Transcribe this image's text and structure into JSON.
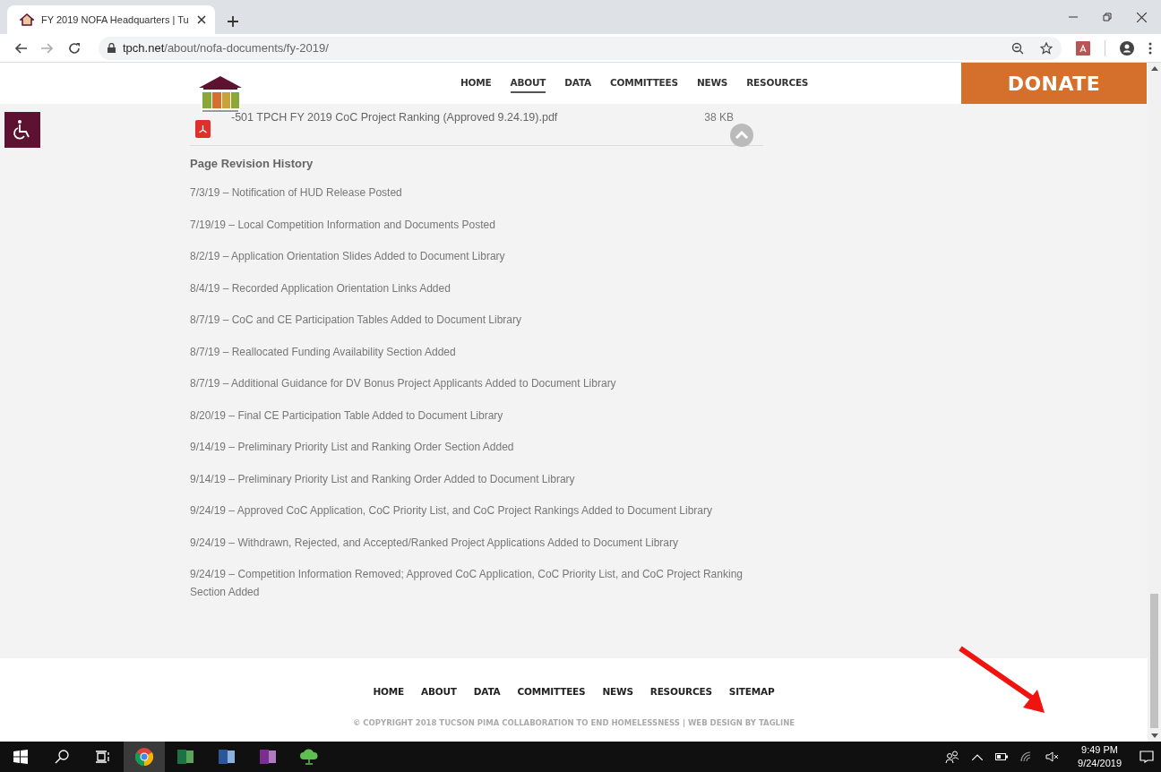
{
  "browser": {
    "tab_title": "FY 2019 NOFA Headquarters | Tu",
    "url_host": "tpch.net",
    "url_path": "/about/nofa-documents/fy-2019/"
  },
  "nav": [
    {
      "label": "HOME",
      "selected": false
    },
    {
      "label": "ABOUT",
      "selected": true
    },
    {
      "label": "DATA",
      "selected": false
    },
    {
      "label": "COMMITTEES",
      "selected": false
    },
    {
      "label": "NEWS",
      "selected": false
    },
    {
      "label": "RESOURCES",
      "selected": false
    }
  ],
  "donate": "DONATE",
  "document": {
    "name": "-501 TPCH FY 2019 CoC Project Ranking (Approved 9.24.19).pdf",
    "size": "38 KB"
  },
  "revision_history": {
    "heading": "Page Revision History",
    "entries": [
      "7/3/19 – Notification of HUD Release Posted",
      "7/19/19 – Local Competition Information and Documents Posted",
      "8/2/19 – Application Orientation Slides Added to Document Library",
      "8/4/19 – Recorded Application Orientation Links Added",
      "8/7/19 – CoC and CE Participation Tables Added to Document Library",
      "8/7/19 – Reallocated Funding Availability Section Added",
      "8/7/19 – Additional Guidance for DV Bonus Project Applicants Added to Document Library",
      "8/20/19 – Final CE Participation Table Added to Document Library",
      "9/14/19 – Preliminary Priority List and Ranking Order Section Added",
      "9/14/19 – Preliminary Priority List and Ranking Order Added to Document Library",
      "9/24/19 – Approved CoC Application, CoC Priority List, and CoC Project Rankings Added to Document Library",
      "9/24/19 – Withdrawn, Rejected, and Accepted/Ranked Project Applications Added to Document Library",
      "9/24/19 – Competition Information Removed; Approved CoC Application, CoC Priority List, and CoC Project Ranking Section Added"
    ]
  },
  "footer": {
    "nav": [
      "HOME",
      "ABOUT",
      "DATA",
      "COMMITTEES",
      "NEWS",
      "RESOURCES",
      "SITEMAP"
    ],
    "copyright": "© COPYRIGHT 2018 TUCSON PIMA COLLABORATION TO END HOMELESSNESS | WEB DESIGN BY TAGLINE"
  },
  "taskbar": {
    "time": "9:49 PM",
    "date": "9/24/2019"
  }
}
